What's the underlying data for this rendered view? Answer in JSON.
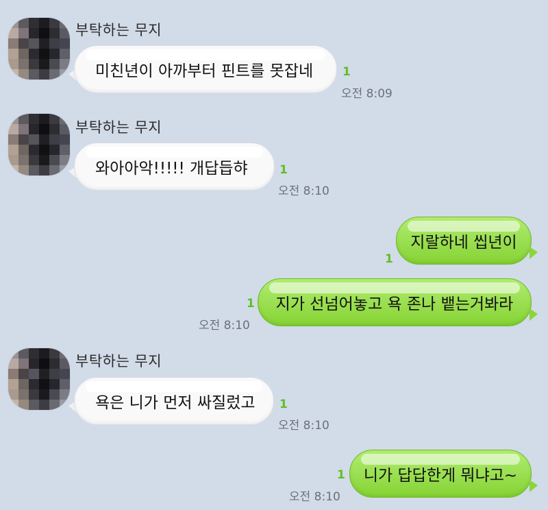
{
  "messages": [
    {
      "direction": "in",
      "sender": "부탁하는 무지",
      "text": "미친년이 아까부터 핀트를 못잡네",
      "unread": "1",
      "time": "오전 8:09"
    },
    {
      "direction": "in",
      "sender": "부탁하는 무지",
      "text": "와아아악!!!!! 개답듭햐",
      "unread": "1",
      "time": "오전 8:10"
    },
    {
      "direction": "out",
      "text": "지랄하네 씹년이",
      "unread": "1",
      "time": ""
    },
    {
      "direction": "out",
      "text": "지가 선넘어놓고 욕 존나 뱉는거봐라",
      "unread": "1",
      "time": "오전 8:10"
    },
    {
      "direction": "in",
      "sender": "부탁하는 무지",
      "text": "욕은 니가 먼저 싸질렀고",
      "unread": "1",
      "time": "오전 8:10"
    },
    {
      "direction": "out",
      "text": "니가 답답한게 뭐냐고~",
      "unread": "1",
      "time": "오전 8:10"
    }
  ],
  "colors": {
    "background": "#d2dbe8",
    "incoming_bubble": "#f9f9f9",
    "outgoing_bubble": "#9be055",
    "unread": "#5fbf24",
    "time": "#6b7079"
  },
  "avatar": {
    "icon": "pixelated-profile-avatar"
  }
}
